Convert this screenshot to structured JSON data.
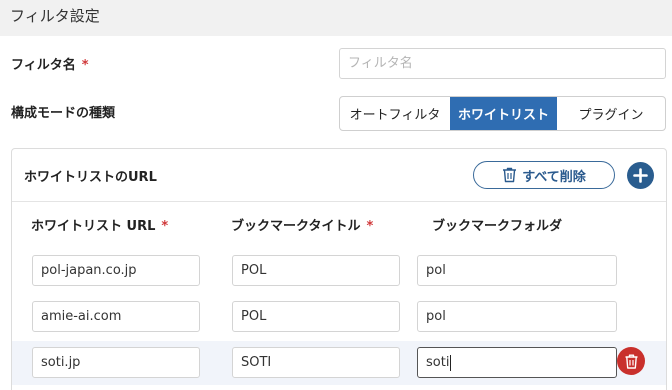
{
  "header": {
    "title": "フィルタ設定"
  },
  "form": {
    "filter_name_label": "フィルタ名",
    "required_mark": "*",
    "filter_name_placeholder": "フィルタ名",
    "filter_name_value": "",
    "mode_label": "構成モードの種類",
    "modes": [
      {
        "label": "オートフィルタ",
        "selected": false
      },
      {
        "label": "ホワイトリスト",
        "selected": true
      },
      {
        "label": "プラグイン",
        "selected": false
      }
    ]
  },
  "whitelist": {
    "title": "ホワイトリストのURL",
    "delete_all_label": "すべて削除",
    "columns": {
      "url": "ホワイトリスト URL",
      "bookmark_title": "ブックマークタイトル",
      "bookmark_folder": "ブックマークフォルダ"
    },
    "rows": [
      {
        "url": "pol-japan.co.jp",
        "title": "POL",
        "folder": "pol"
      },
      {
        "url": "amie-ai.com",
        "title": "POL",
        "folder": "pol"
      },
      {
        "url": "soti.jp",
        "title": "SOTI",
        "folder": "soti"
      }
    ]
  },
  "colors": {
    "accent": "#2f6db2",
    "add_button": "#2a5d8f",
    "delete_button": "#c9302c",
    "required": "#d0383a"
  },
  "icons": {
    "delete_all": "trash-icon",
    "add": "plus-icon",
    "row_delete": "trash-icon"
  }
}
